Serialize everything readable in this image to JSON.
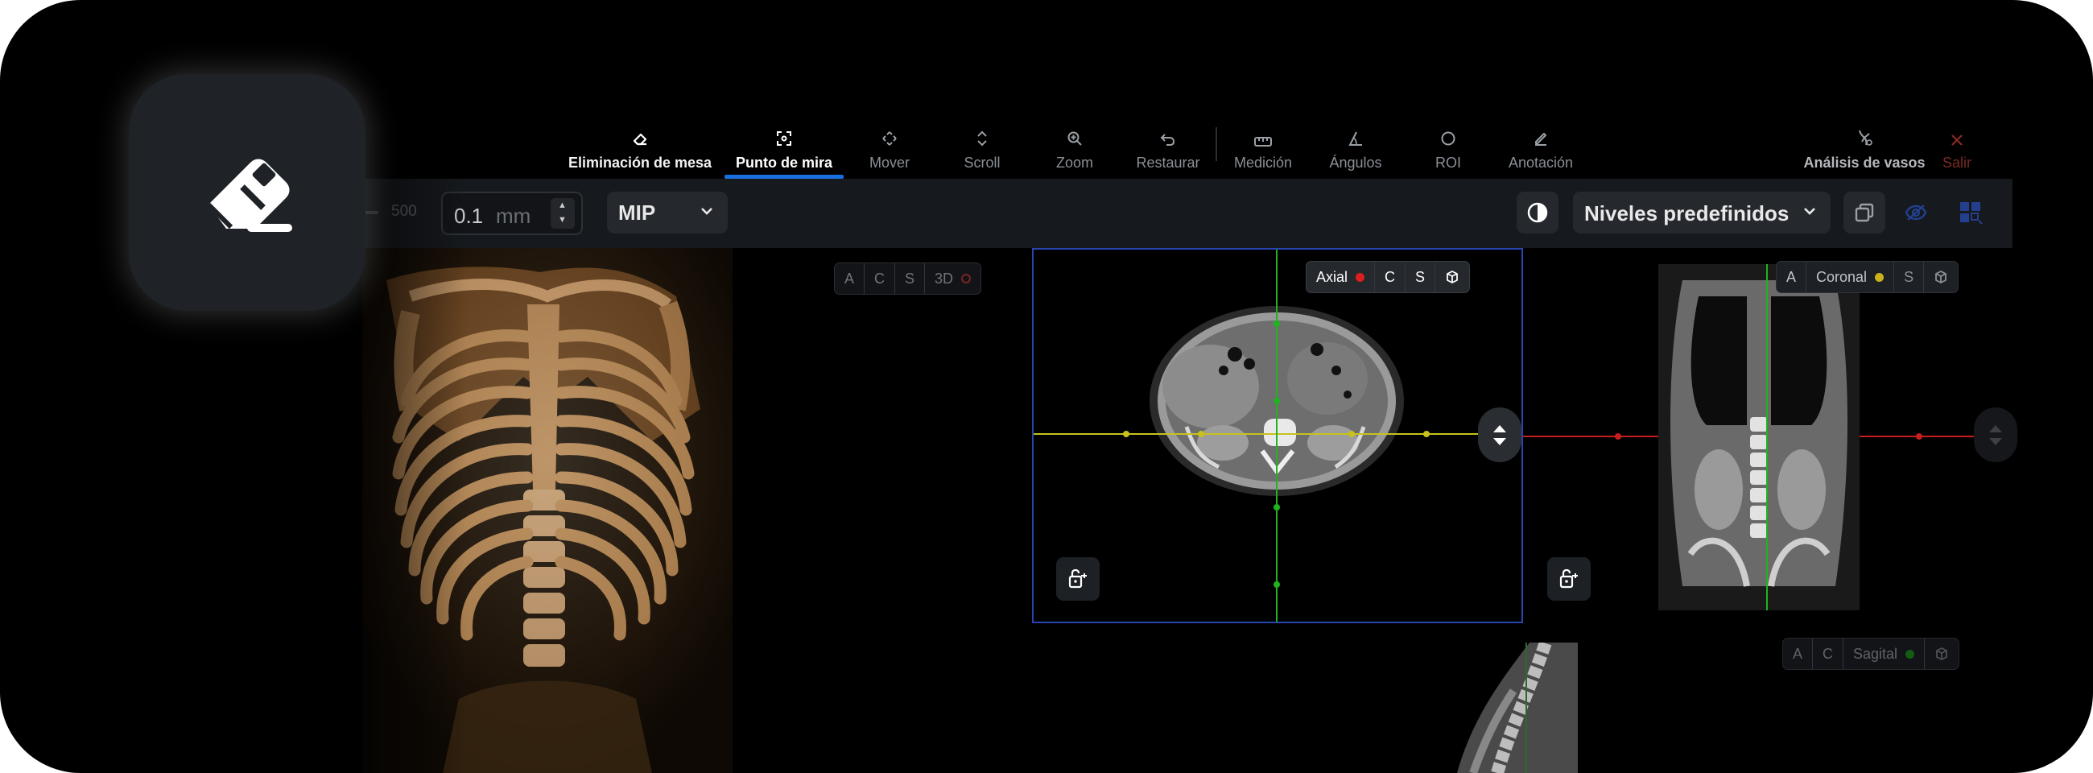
{
  "toolbar": {
    "items": [
      {
        "label": "Eliminación de mesa",
        "icon": "eraser-icon"
      },
      {
        "label": "Punto de mira",
        "icon": "crosshair-icon"
      },
      {
        "label": "Mover",
        "icon": "move-icon"
      },
      {
        "label": "Scroll",
        "icon": "scroll-icon"
      },
      {
        "label": "Zoom",
        "icon": "zoom-icon"
      },
      {
        "label": "Restaurar",
        "icon": "undo-icon"
      },
      {
        "label": "Medición",
        "icon": "ruler-icon"
      },
      {
        "label": "Ángulos",
        "icon": "angle-icon"
      },
      {
        "label": "ROI",
        "icon": "circle-icon"
      },
      {
        "label": "Anotación",
        "icon": "pencil-icon"
      }
    ],
    "active": "Punto de mira",
    "vessel_analysis": "Análisis de vasos",
    "exit": "Salir"
  },
  "controls": {
    "slider_value": "500",
    "thickness_value": "0.1",
    "thickness_unit": "mm",
    "render_mode": "MIP",
    "presets_label": "Niveles predefinidos"
  },
  "viewports": {
    "vr": {
      "tabs": [
        "A",
        "C",
        "S",
        "3D"
      ]
    },
    "axial": {
      "tabs": [
        "Axial",
        "C",
        "S"
      ],
      "crosshair_color": "#dc1e1e"
    },
    "coronal": {
      "tabs": [
        "A",
        "Coronal",
        "S"
      ],
      "crosshair_color": "#c9b21c"
    },
    "sagittal": {
      "tabs": [
        "A",
        "C",
        "Sagital"
      ],
      "crosshair_color": "#1fb31f"
    }
  },
  "colors": {
    "accent": "#1a6fe0",
    "exit": "#c0392b",
    "axial_border": "#2946b0",
    "yellow_line": "#c8c21c",
    "green_line": "#1fb31f",
    "red_line": "#c41e1e"
  }
}
